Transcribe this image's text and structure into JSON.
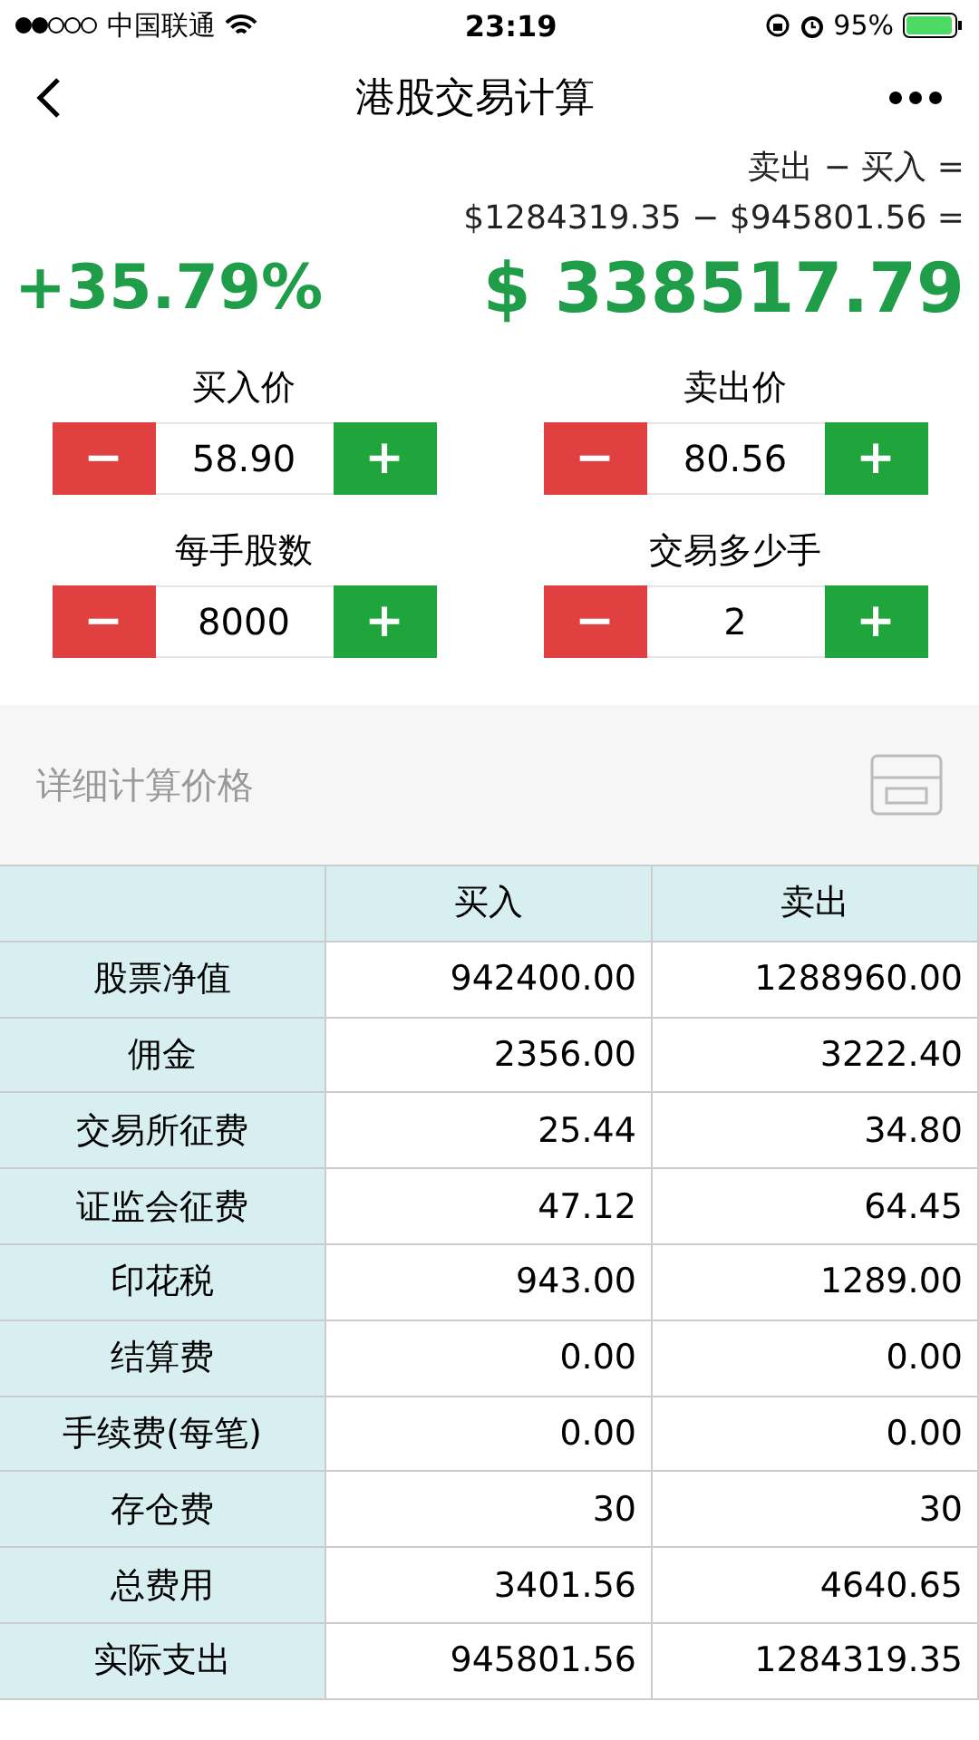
{
  "status_bar": {
    "carrier": "中国联通",
    "time": "23:19",
    "battery": "95%"
  },
  "nav": {
    "title": "港股交易计算"
  },
  "summary": {
    "formula": "卖出 − 买入 =",
    "formula_values": "$1284319.35 − $945801.56 =",
    "percent": "+35.79%",
    "profit": "$ 338517.79"
  },
  "steppers": [
    {
      "label": "买入价",
      "value": "58.90",
      "minus": "−",
      "plus": "+"
    },
    {
      "label": "卖出价",
      "value": "80.56",
      "minus": "−",
      "plus": "+"
    },
    {
      "label": "每手股数",
      "value": "8000",
      "minus": "−",
      "plus": "+"
    },
    {
      "label": "交易多少手",
      "value": "2",
      "minus": "−",
      "plus": "+"
    }
  ],
  "detail": {
    "title": "详细计算价格"
  },
  "table": {
    "columns": [
      "买入",
      "卖出"
    ],
    "rows": [
      {
        "label": "股票净值",
        "buy": "942400.00",
        "sell": "1288960.00"
      },
      {
        "label": "佣金",
        "buy": "2356.00",
        "sell": "3222.40"
      },
      {
        "label": "交易所征费",
        "buy": "25.44",
        "sell": "34.80"
      },
      {
        "label": "证监会征费",
        "buy": "47.12",
        "sell": "64.45"
      },
      {
        "label": "印花税",
        "buy": "943.00",
        "sell": "1289.00"
      },
      {
        "label": "结算费",
        "buy": "0.00",
        "sell": "0.00"
      },
      {
        "label": "手续费(每笔)",
        "buy": "0.00",
        "sell": "0.00"
      },
      {
        "label": "存仓费",
        "buy": "30",
        "sell": "30"
      },
      {
        "label": "总费用",
        "buy": "3401.56",
        "sell": "4640.65"
      },
      {
        "label": "实际支出",
        "buy": "945801.56",
        "sell": "1284319.35"
      }
    ]
  }
}
